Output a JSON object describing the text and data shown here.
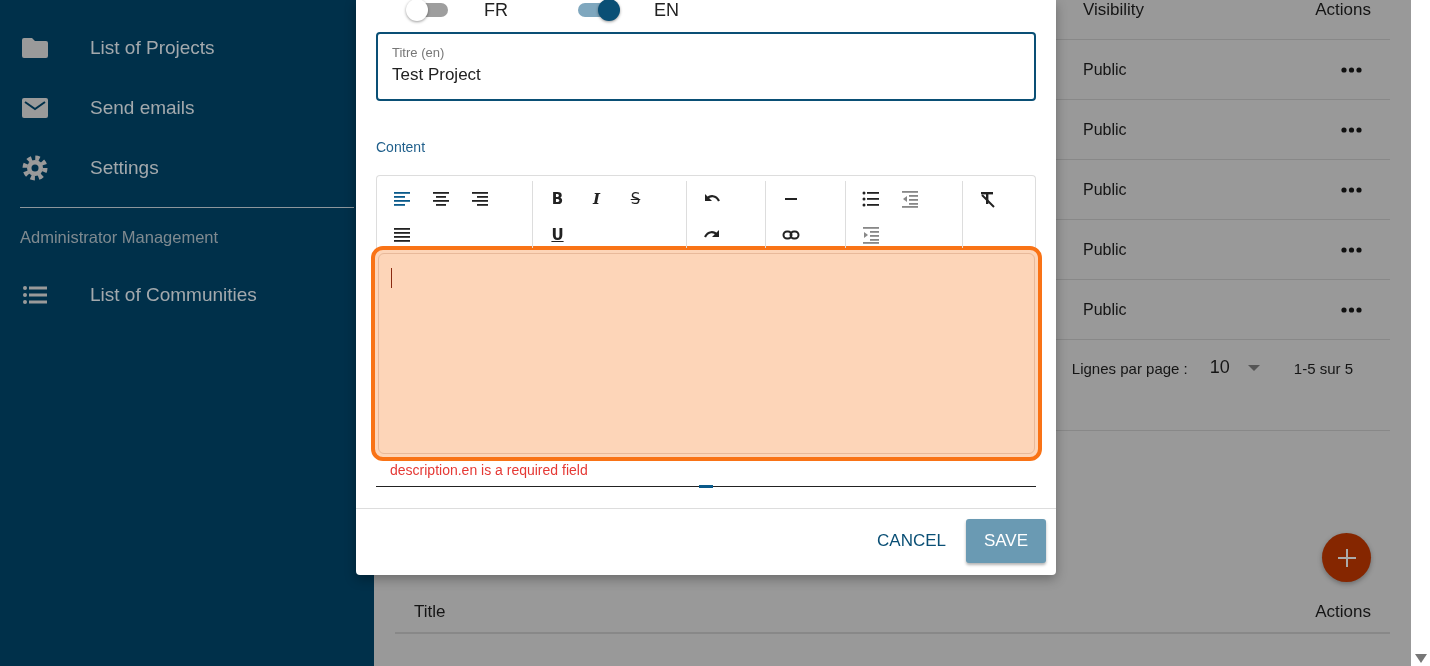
{
  "sidebar": {
    "items": [
      {
        "label": "List of Projects",
        "kind": "folder"
      },
      {
        "label": "Send emails",
        "kind": "mail"
      },
      {
        "label": "Settings",
        "kind": "gear"
      }
    ],
    "section_title": "Administrator Management",
    "admin_items": [
      {
        "label": "List of Communities",
        "kind": "list"
      }
    ]
  },
  "table": {
    "columns": [
      "Visibility",
      "Actions"
    ],
    "rows": [
      {
        "visibility": "Public"
      },
      {
        "visibility": "Public"
      },
      {
        "visibility": "Public"
      },
      {
        "visibility": "Public"
      },
      {
        "visibility": "Public"
      }
    ],
    "pagination": {
      "label": "Lignes par page :",
      "rows_per_page": "10",
      "range": "1-5 sur 5"
    }
  },
  "second_table": {
    "columns": [
      "Title",
      "Actions"
    ]
  },
  "dialog": {
    "language_toggles": [
      {
        "label": "FR",
        "on": false
      },
      {
        "label": "EN",
        "on": true
      }
    ],
    "title_field": {
      "label": "Titre (en)",
      "value": "Test Project"
    },
    "content_label": "Content",
    "toolbar": [
      {
        "tools": [
          {
            "kind": "align-left",
            "selected": true
          },
          {
            "kind": "align-center",
            "selected": false
          },
          {
            "kind": "align-right",
            "selected": false
          },
          {
            "kind": "justify",
            "selected": false
          }
        ]
      },
      {
        "tools": [
          {
            "kind": "bold",
            "glyph": "B",
            "selected": false
          },
          {
            "kind": "italic",
            "glyph": "I",
            "selected": false
          },
          {
            "kind": "strike",
            "glyph": "S",
            "selected": false
          },
          {
            "kind": "underline",
            "glyph": "U",
            "selected": false
          }
        ]
      },
      {
        "tools": [
          {
            "kind": "undo",
            "selected": false
          },
          {
            "kind": "redo",
            "selected": false
          }
        ]
      },
      {
        "tools": [
          {
            "kind": "rule",
            "selected": false
          },
          {
            "kind": "link",
            "selected": false
          }
        ]
      },
      {
        "tools": [
          {
            "kind": "bullets",
            "selected": false
          },
          {
            "kind": "outdent",
            "selected": false
          },
          {
            "kind": "indent",
            "selected": false
          }
        ]
      },
      {
        "tools": [
          {
            "kind": "clear",
            "selected": false
          }
        ]
      }
    ],
    "error": "description.en is a required field",
    "buttons": [
      {
        "label": "CANCEL",
        "kind": "text"
      },
      {
        "label": "SAVE",
        "kind": "contained"
      }
    ]
  }
}
